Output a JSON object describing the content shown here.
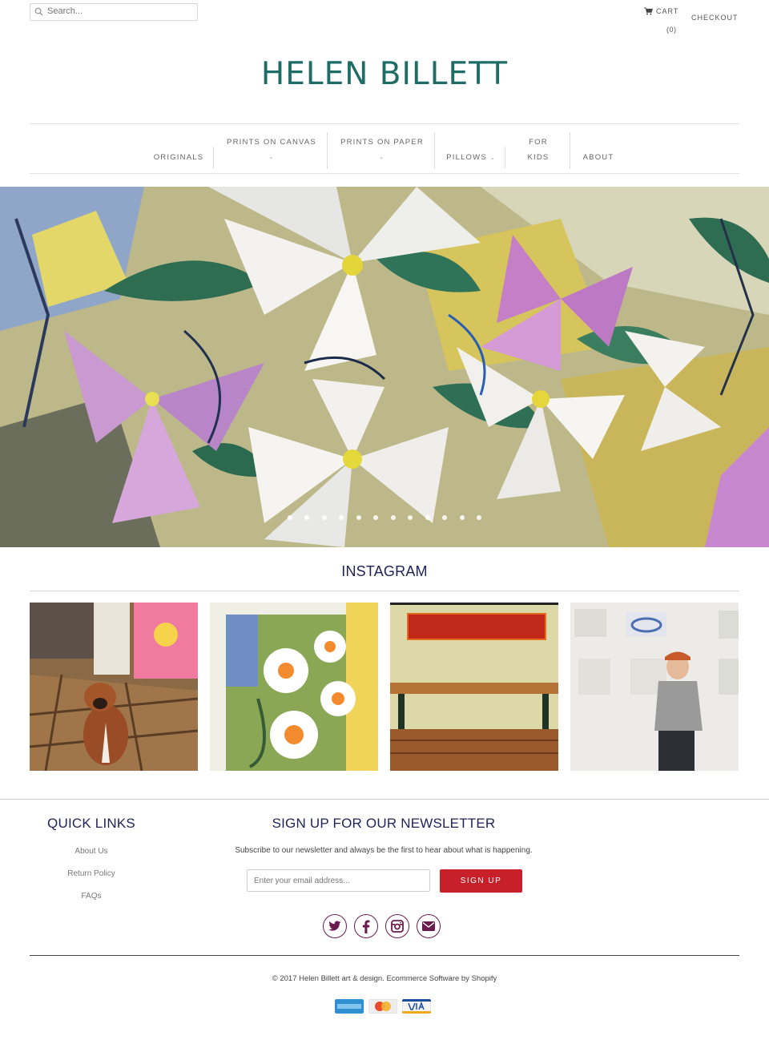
{
  "search": {
    "placeholder": "Search..."
  },
  "header": {
    "cart_label": "CART",
    "cart_count": "(0)",
    "checkout_label": "CHECKOUT",
    "logo": "HELEN BILLETT"
  },
  "nav": {
    "originals": "ORIGINALS",
    "prints_canvas": "PRINTS ON CANVAS",
    "prints_paper": "PRINTS ON PAPER",
    "pillows": "PILLOWS",
    "for_kids_1": "FOR",
    "for_kids_2": "KIDS",
    "about": "ABOUT"
  },
  "instagram": {
    "title": "INSTAGRAM"
  },
  "footer": {
    "quick_links_title": "QUICK LINKS",
    "quick_links": [
      "About Us",
      "Return Policy",
      "FAQs"
    ],
    "newsletter_title": "SIGN UP FOR OUR NEWSLETTER",
    "newsletter_desc": "Subscribe to our newsletter and always be the first to hear about what is happening.",
    "email_placeholder": "Enter your email address...",
    "signup_label": "SIGN UP",
    "copyright": "© 2017 Helen Billett art & design.",
    "software": "Ecommerce Software by Shopify",
    "payment_methods": [
      "american-express",
      "master",
      "visa"
    ]
  },
  "colors": {
    "logo": "#1e6c66",
    "heading": "#1f2258",
    "accent": "#c8202a",
    "social": "#6a1b4d"
  }
}
